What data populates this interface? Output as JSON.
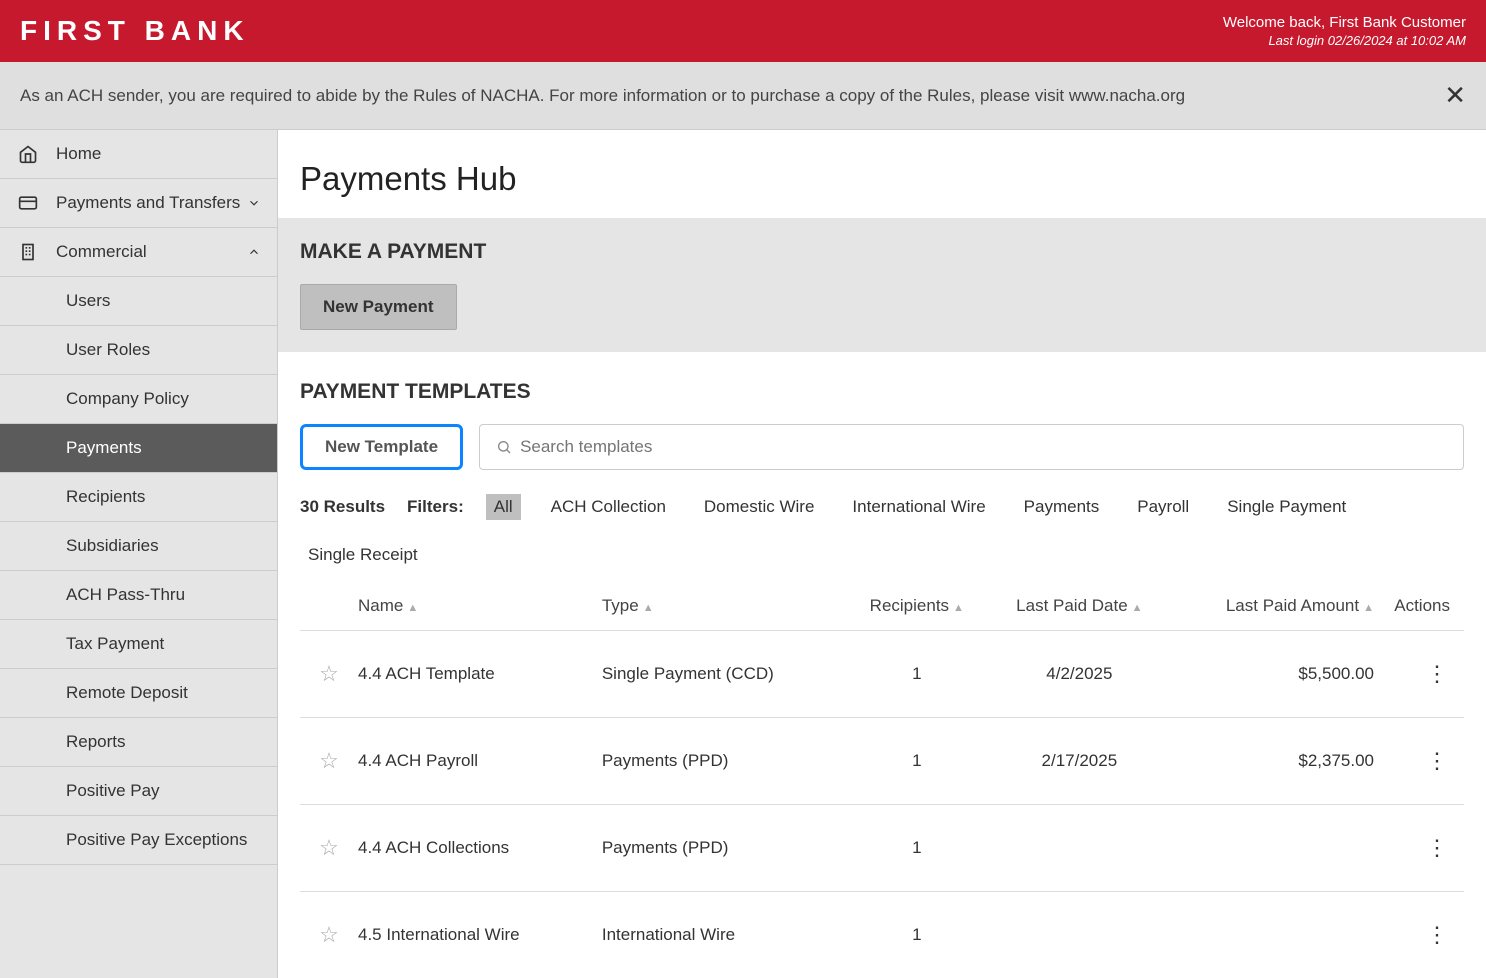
{
  "header": {
    "logo": "FIRST BANK",
    "welcome": "Welcome back, First Bank Customer",
    "last_login": "Last login 02/26/2024 at 10:02 AM"
  },
  "notice": {
    "text": "As an ACH sender, you are required to abide by the Rules of NACHA. For more information or to purchase a copy of the Rules, please visit www.nacha.org"
  },
  "sidebar": {
    "home": "Home",
    "payments_transfers": "Payments and Transfers",
    "commercial": "Commercial",
    "sub": [
      "Users",
      "User Roles",
      "Company Policy",
      "Payments",
      "Recipients",
      "Subsidiaries",
      "ACH Pass-Thru",
      "Tax Payment",
      "Remote Deposit",
      "Reports",
      "Positive Pay",
      "Positive Pay Exceptions"
    ]
  },
  "main": {
    "title": "Payments Hub",
    "make_payment": "MAKE A PAYMENT",
    "new_payment": "New Payment",
    "templates_heading": "PAYMENT TEMPLATES",
    "new_template": "New Template",
    "search_placeholder": "Search templates",
    "results_count": "30 Results",
    "filters_label": "Filters:",
    "filters": [
      "All",
      "ACH Collection",
      "Domestic Wire",
      "International Wire",
      "Payments",
      "Payroll",
      "Single Payment",
      "Single Receipt"
    ],
    "columns": {
      "name": "Name",
      "type": "Type",
      "recipients": "Recipients",
      "last_paid_date": "Last Paid Date",
      "last_paid_amount": "Last Paid Amount",
      "actions": "Actions"
    },
    "rows": [
      {
        "name": "4.4 ACH Template",
        "type": "Single Payment (CCD)",
        "recipients": "1",
        "date": "4/2/2025",
        "amount": "$5,500.00"
      },
      {
        "name": "4.4 ACH Payroll",
        "type": "Payments (PPD)",
        "recipients": "1",
        "date": "2/17/2025",
        "amount": "$2,375.00"
      },
      {
        "name": "4.4 ACH Collections",
        "type": "Payments (PPD)",
        "recipients": "1",
        "date": "",
        "amount": ""
      },
      {
        "name": "4.5 International Wire",
        "type": "International Wire",
        "recipients": "1",
        "date": "",
        "amount": ""
      }
    ]
  }
}
